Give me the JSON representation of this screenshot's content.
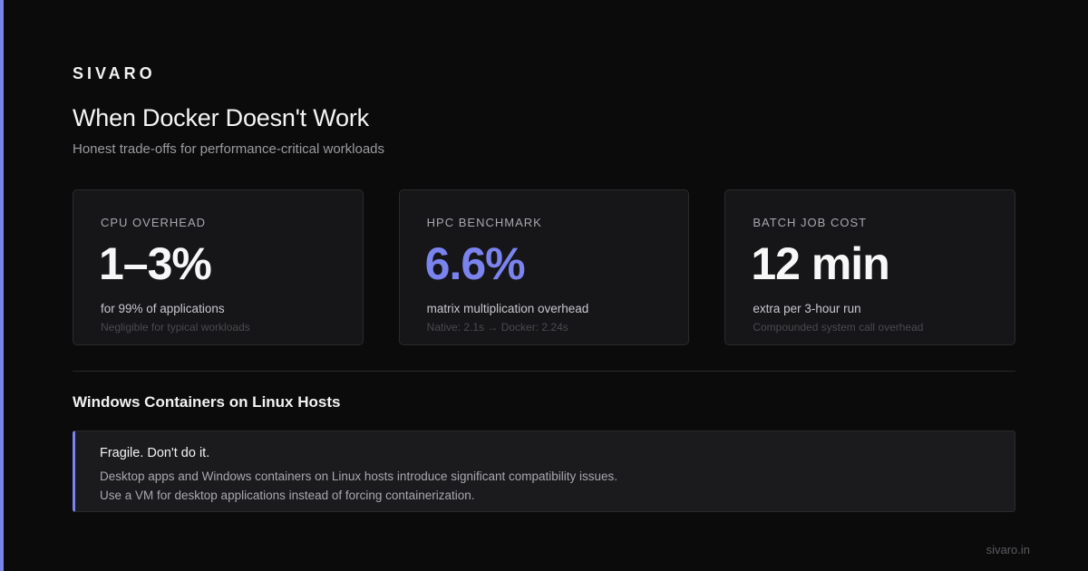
{
  "brand": "SIVARO",
  "title": "When Docker Doesn't Work",
  "subtitle": "Honest trade-offs for performance-critical workloads",
  "accent_color": "#7b83ee",
  "cards": [
    {
      "label": "CPU OVERHEAD",
      "value": "1–3%",
      "description": "for 99% of applications",
      "note": "Negligible for typical workloads"
    },
    {
      "label": "HPC BENCHMARK",
      "value": "6.6%",
      "description": "matrix multiplication overhead",
      "note": "Native: 2.1s → Docker: 2.24s"
    },
    {
      "label": "BATCH JOB COST",
      "value": "12 min",
      "description": "extra per 3-hour run",
      "note": "Compounded system call overhead"
    }
  ],
  "section": {
    "title": "Windows Containers on Linux Hosts"
  },
  "callout": {
    "title": "Fragile. Don't do it.",
    "line1": "Desktop apps and Windows containers on Linux hosts introduce significant compatibility issues.",
    "line2": "Use a VM for desktop applications instead of forcing containerization."
  },
  "footer": "sivaro.in"
}
